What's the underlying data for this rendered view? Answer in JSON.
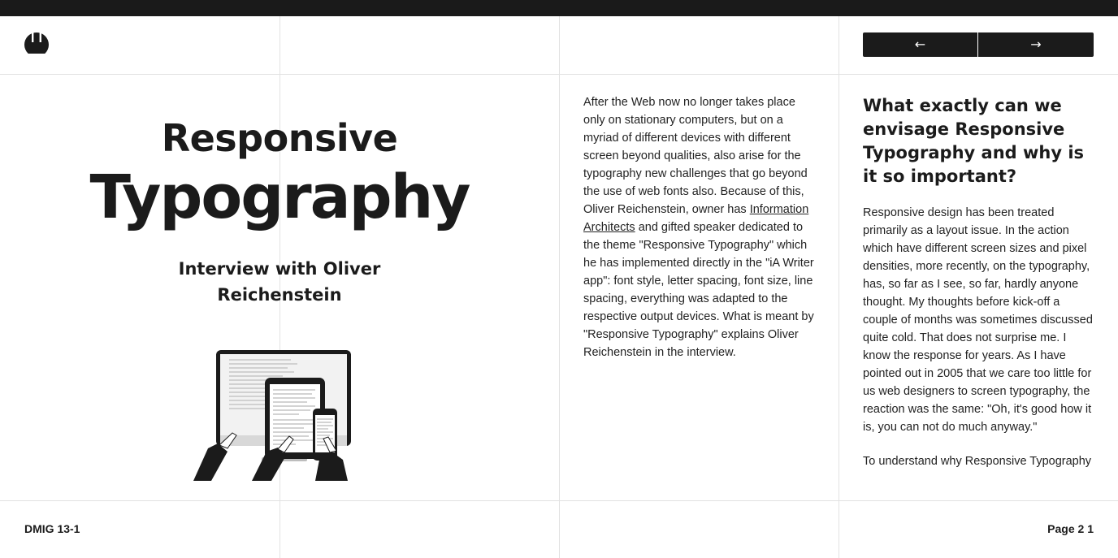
{
  "header": {
    "logo": "logo-icon",
    "nav": {
      "prev_symbol": "←",
      "next_symbol": "→"
    }
  },
  "article": {
    "title_line_1": "Responsive",
    "title_line_2": "Typography",
    "subtitle": "Interview with Oliver Reichenstein",
    "illustration": "devices-illustration",
    "intro_before_link": "After the Web now no longer takes place only on stationary computers, but on a myriad of different devices with different screen beyond qualities, also arise for the typography new challenges that go beyond the use of web fonts also. Because of this, Oliver Reichenstein, owner has ",
    "intro_link": "Information Architects",
    "intro_after_link": " and gifted speaker dedicated to the theme \"Responsive Typography\" which he has implemented directly in the \"iA Writer app\": font style, letter spacing, font size, line spacing, everything was adapted to the respective output devices. What is meant by \"Responsive Typography\" explains Oliver Reichenstein in the interview.",
    "question": "What exactly can we envisage Responsive Typography and why is it so important?",
    "answer_paragraph_1": "Responsive design has been treated primarily as a layout issue. In the action which have different screen sizes and pixel densities, more recently, on the typography, has, so far as I see, so far, hardly anyone thought. My thoughts before kick-off a couple of months was sometimes discussed quite cold. That does not surprise me. I know the response for years. As I have pointed out in 2005 that we care too little for us web designers to screen typography, the reaction was the same: \"Oh, it's good how it is, you can not do much anyway.\"",
    "answer_paragraph_2": "To understand why Responsive Typography"
  },
  "footer": {
    "issue": "DMIG 13-1",
    "page": "Page 2 1"
  },
  "colors": {
    "top_bar": "#1a1a1a",
    "button_bg": "#1b1b1b",
    "grid_lines": "#e2e2e2",
    "text": "#1b1b1b"
  }
}
